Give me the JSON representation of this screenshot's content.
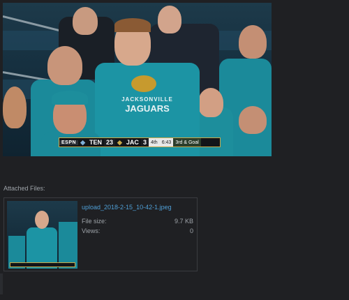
{
  "post_image": {
    "shirt_text_line1": "JACKSONVILLE",
    "shirt_text_line2": "JAGUARS",
    "scorebug": {
      "network": "ESPN",
      "team_away": "TEN",
      "score_away": "23",
      "team_home": "JAC",
      "score_home": "3",
      "quarter": "4th",
      "clock": "6:43",
      "down": "3rd & Goal"
    }
  },
  "attachments": {
    "label": "Attached Files:",
    "file": {
      "name": "upload_2018-2-15_10-42-1.jpeg",
      "size_label": "File size:",
      "size_value": "9.7 KB",
      "views_label": "Views:",
      "views_value": "0"
    }
  },
  "colors": {
    "background": "#1f2023",
    "link": "#4f9fd6",
    "jersey_teal": "#1b8a9a"
  }
}
